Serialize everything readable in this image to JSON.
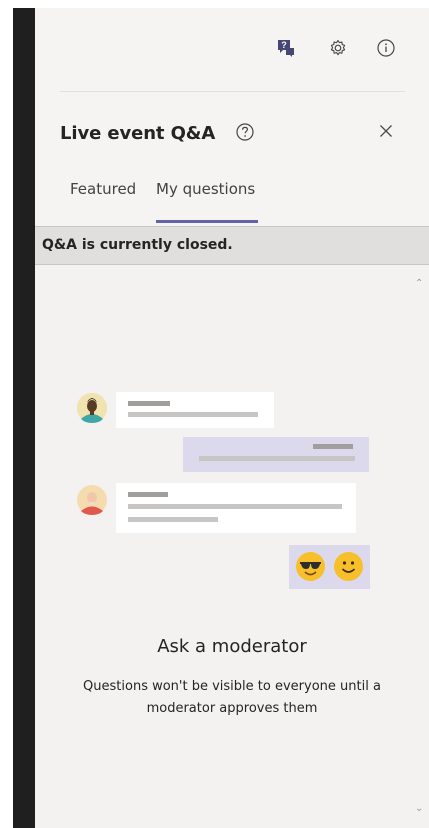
{
  "header": {
    "title": "Live event Q&A",
    "icons": [
      "qa-icon",
      "gear-icon",
      "info-icon",
      "help-icon",
      "close-icon"
    ]
  },
  "tabs": [
    {
      "label": "Featured",
      "selected": false
    },
    {
      "label": "My questions",
      "selected": true
    }
  ],
  "banner": {
    "text": "Q&A is currently closed."
  },
  "empty_state": {
    "heading": "Ask a moderator",
    "description_line1": "Questions won't be visible to everyone until a",
    "description_line2": "moderator approves them",
    "emojis": [
      "sunglasses-emoji",
      "smile-emoji"
    ]
  },
  "colors": {
    "accent": "#6264a7",
    "panel_bg": "#f5f4f2",
    "banner_bg": "#e1dfdd",
    "rail": "#1f1f1f",
    "bubble_purple": "#ddd9ec"
  }
}
